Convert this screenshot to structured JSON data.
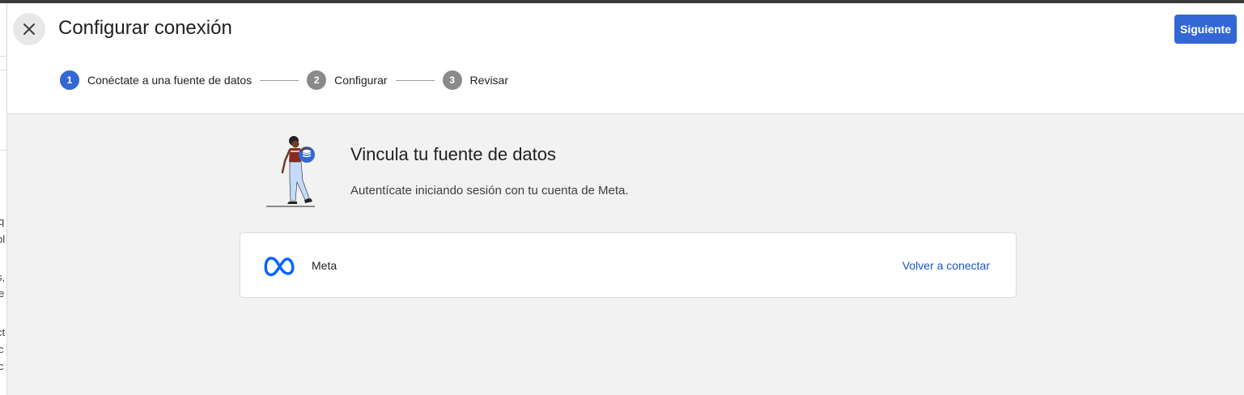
{
  "underlay": {
    "fragments": [
      "q",
      "bl",
      "s,",
      "e",
      "ct",
      "c",
      "c"
    ]
  },
  "header": {
    "title": "Configurar conexión",
    "next_label": "Siguiente",
    "close_icon": "close-icon"
  },
  "stepper": {
    "steps": [
      {
        "number": "1",
        "label": "Conéctate a una fuente de datos",
        "state": "active"
      },
      {
        "number": "2",
        "label": "Configurar",
        "state": "inactive"
      },
      {
        "number": "3",
        "label": "Revisar",
        "state": "inactive"
      }
    ]
  },
  "main": {
    "heading": "Vincula tu fuente de datos",
    "subtext": "Autentícate iniciando sesión con tu cuenta de Meta.",
    "illustration_icon": "person-with-database-illustration"
  },
  "card": {
    "name": "Meta",
    "logo_icon": "meta-logo-icon",
    "action_label": "Volver a conectar"
  },
  "colors": {
    "accent": "#3367d6",
    "link": "#1a56c7",
    "background": "#f2f2f2",
    "meta_blue": "#0866ff"
  }
}
